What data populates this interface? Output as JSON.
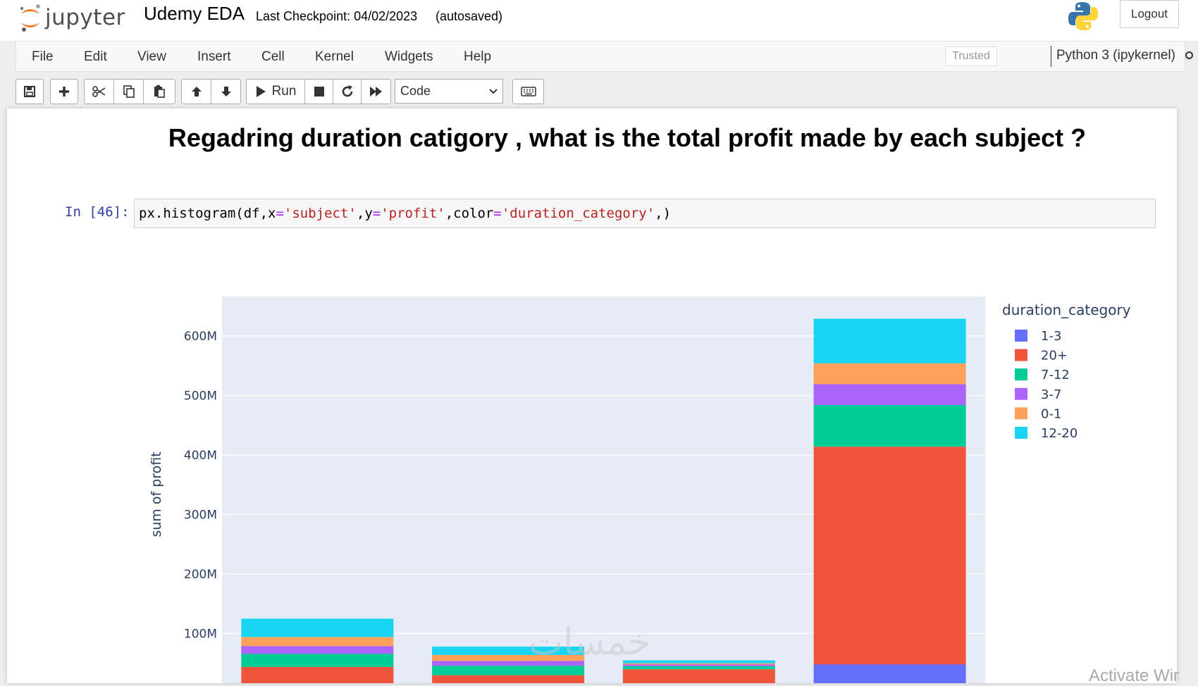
{
  "header": {
    "logo_text": "jupyter",
    "notebook_name": "Udemy EDA",
    "checkpoint": "Last Checkpoint: 04/02/2023",
    "autosave": "(autosaved)",
    "logout": "Logout"
  },
  "menu": {
    "items": [
      "File",
      "Edit",
      "View",
      "Insert",
      "Cell",
      "Kernel",
      "Widgets",
      "Help"
    ],
    "trusted": "Trusted",
    "kernel": "Python 3 (ipykernel)"
  },
  "toolbar": {
    "run_label": "Run",
    "cell_type": "Code"
  },
  "notebook": {
    "heading": "Regadring duration catigory , what is the total profit made by each subject ?",
    "prompt": "In [46]:",
    "code": {
      "fn": "px.histogram(df,x",
      "eq1": "=",
      "s1": "'subject'",
      "c1": ",y",
      "eq2": "=",
      "s2": "'profit'",
      "c2": ",color",
      "eq3": "=",
      "s3": "'duration_category'",
      "end": ",)"
    }
  },
  "chart_data": {
    "type": "bar",
    "stacked": true,
    "ylabel": "sum of profit",
    "legend_title": "duration_category",
    "legend_position": "top-right",
    "y_ticks": [
      "100M",
      "200M",
      "300M",
      "400M",
      "500M",
      "600M"
    ],
    "y_tick_values": [
      100000000,
      200000000,
      300000000,
      400000000,
      500000000,
      600000000
    ],
    "grid": true,
    "series": [
      {
        "name": "1-3",
        "color": "#636efa",
        "values": [
          8000000,
          4000000,
          2000000,
          48000000
        ]
      },
      {
        "name": "20+",
        "color": "#ef553b",
        "values": [
          36000000,
          26000000,
          38000000,
          366000000
        ]
      },
      {
        "name": "7-12",
        "color": "#00cc96",
        "values": [
          22000000,
          16000000,
          5000000,
          70000000
        ]
      },
      {
        "name": "3-7",
        "color": "#ab63fa",
        "values": [
          13000000,
          8000000,
          3000000,
          35000000
        ]
      },
      {
        "name": "0-1",
        "color": "#ffa15a",
        "values": [
          15000000,
          10000000,
          2000000,
          35000000
        ]
      },
      {
        "name": "12-20",
        "color": "#19d3f3",
        "values": [
          31000000,
          14000000,
          5000000,
          75000000
        ]
      }
    ]
  },
  "overlay": {
    "watermark": "خمسات",
    "activate": "Activate Wir"
  }
}
